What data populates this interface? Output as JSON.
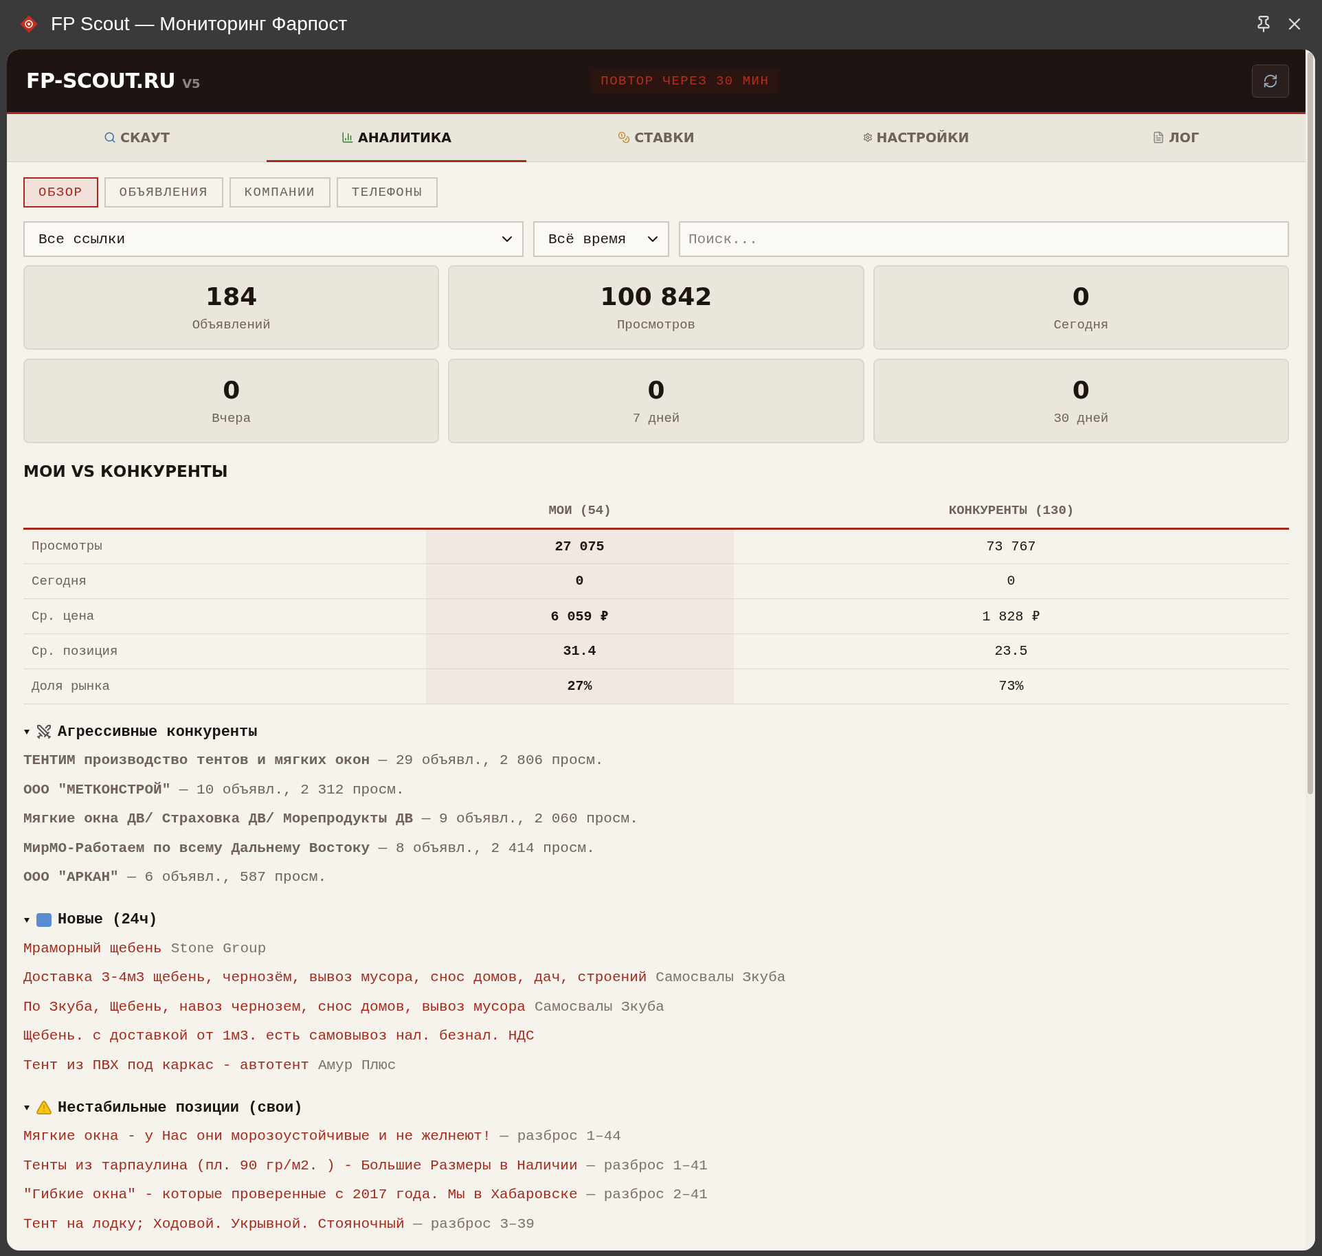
{
  "window": {
    "title": "FP Scout — Мониторинг Фарпост"
  },
  "header": {
    "logo": "FP-SCOUT.RU",
    "version": "V5",
    "status": "ПОВТОР ЧЕРЕЗ 30 МИН"
  },
  "tabs": [
    {
      "label": "СКАУТ",
      "selected": false
    },
    {
      "label": "АНАЛИТИКА",
      "selected": true
    },
    {
      "label": "СТАВКИ",
      "selected": false
    },
    {
      "label": "НАСТРОЙКИ",
      "selected": false
    },
    {
      "label": "ЛОГ",
      "selected": false
    }
  ],
  "subtabs": [
    {
      "label": "ОБЗОР",
      "selected": true
    },
    {
      "label": "ОБЪЯВЛЕНИЯ",
      "selected": false
    },
    {
      "label": "КОМПАНИИ",
      "selected": false
    },
    {
      "label": "ТЕЛЕФОНЫ",
      "selected": false
    }
  ],
  "filters": {
    "links": "Все ссылки",
    "period": "Всё время",
    "search": {
      "placeholder": "Поиск..."
    }
  },
  "stats": [
    {
      "value": "184",
      "label": "Объявлений"
    },
    {
      "value": "100 842",
      "label": "Просмотров"
    },
    {
      "value": "0",
      "label": "Сегодня"
    },
    {
      "value": "0",
      "label": "Вчера"
    },
    {
      "value": "0",
      "label": "7 дней"
    },
    {
      "value": "0",
      "label": "30 дней"
    }
  ],
  "comparison": {
    "title": "МОИ VS КОНКУРЕНТЫ",
    "columns": [
      "МОИ (54)",
      "КОНКУРЕНТЫ (130)"
    ],
    "rows": [
      {
        "label": "Просмотры",
        "mine": "27 075",
        "theirs": "73 767"
      },
      {
        "label": "Сегодня",
        "mine": "0",
        "theirs": "0"
      },
      {
        "label": "Ср. цена",
        "mine": "6 059 ₽",
        "theirs": "1 828 ₽"
      },
      {
        "label": "Ср. позиция",
        "mine": "31.4",
        "theirs": "23.5"
      },
      {
        "label": "Доля рынка",
        "mine": "27%",
        "theirs": "73%"
      }
    ]
  },
  "sections": [
    {
      "kind": "competitors",
      "title": "Агрессивные конкуренты",
      "expanded": true,
      "items": [
        {
          "text": "**ТЕНТИМ производство тентов и мягких окон** — 29 объявл., 2 806 просм."
        },
        {
          "text": "**ООО \"МЕТКОНСТРОЙ\"** — 10 объявл., 2 312 просм."
        },
        {
          "text": "**Мягкие окна ДВ/ Страховка ДВ/ Морепродукты ДВ** — 9 объявл., 2 060 просм."
        },
        {
          "text": "**МирМО-Работаем по всему Дальнему Востоку** — 8 объявл., 2 414 просм."
        },
        {
          "text": "**ООО \"АРКАН\"** — 6 объявл., 587 просм."
        }
      ]
    },
    {
      "kind": "listings",
      "title": "Новые (24ч)",
      "expanded": true,
      "items": [
        {
          "title": "Мраморный щебень",
          "extra": "Stone Group"
        },
        {
          "title": "Доставка 3-4м3 щебень, чернозём, вывоз мусора, снос домов, дач, строений",
          "extra": "Самосвалы Зкуба"
        },
        {
          "title": "По Зкуба, Щебень, навоз чернозем, снос домов, вывоз мусора",
          "extra": "Самосвалы Зкуба"
        },
        {
          "title": "Щебень. с доставкой от 1м3. есть самовывоз нал. безнал. НДС"
        },
        {
          "title": "Тент из ПВХ под каркас - автотент",
          "extra": "Амур Плюс"
        }
      ]
    },
    {
      "kind": "listings",
      "title": "Нестабильные позиции (свои)",
      "expanded": true,
      "items": [
        {
          "title": "Мягкие окна - у Нас они морозоустойчивые и не желнеют!",
          "extra": "— разброс 1–44"
        },
        {
          "title": "Тенты из тарпаулина (пл. 90 гр/м2. ) - Большие Размеры в Наличии",
          "extra": "— разброс 1–41"
        },
        {
          "title": "\"Гибкие окна\" - которые проверенные с 2017 года. Мы в Хабаровске",
          "extra": "— разброс 2–41"
        },
        {
          "title": "Тент на лодку; Ходовой. Укрывной. Стояночный",
          "extra": "— разброс 3–39"
        }
      ]
    }
  ]
}
